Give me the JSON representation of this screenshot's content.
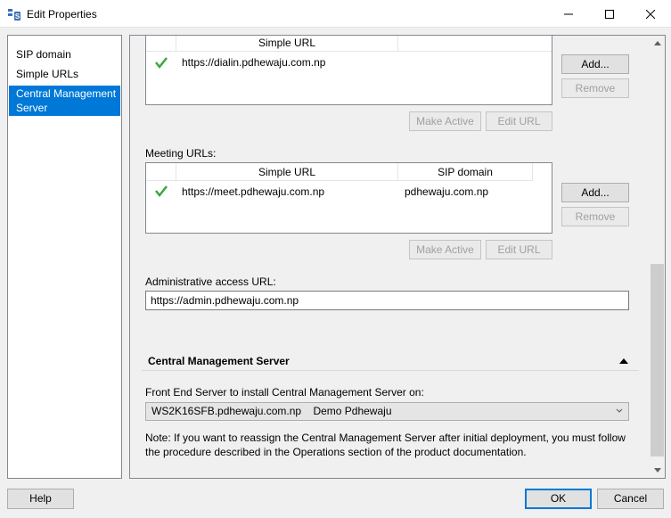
{
  "window": {
    "title": "Edit Properties",
    "icon": "skype-server-icon",
    "controls": {
      "minimize": "minimize-icon",
      "maximize": "maximize-icon",
      "close": "close-icon"
    }
  },
  "nav": {
    "items": [
      {
        "label": "SIP domain",
        "selected": false
      },
      {
        "label": "Simple URLs",
        "selected": false
      },
      {
        "label": "Central Management Server",
        "selected": true
      }
    ]
  },
  "dialin": {
    "column_header": "Simple URL",
    "rows": [
      {
        "url": "https://dialin.pdhewaju.com.np",
        "active": true
      }
    ],
    "add_label": "Add...",
    "remove_label": "Remove",
    "make_active_label": "Make Active",
    "edit_url_label": "Edit URL"
  },
  "meeting": {
    "label": "Meeting URLs:",
    "headers": {
      "simple_url": "Simple URL",
      "sip_domain": "SIP domain"
    },
    "rows": [
      {
        "url": "https://meet.pdhewaju.com.np",
        "sip_domain": "pdhewaju.com.np",
        "active": true
      }
    ],
    "add_label": "Add...",
    "remove_label": "Remove",
    "make_active_label": "Make Active",
    "edit_url_label": "Edit URL"
  },
  "admin": {
    "label": "Administrative access URL:",
    "value": "https://admin.pdhewaju.com.np"
  },
  "cms": {
    "section_title": "Central Management Server",
    "front_end_label": "Front End Server to install Central Management Server on:",
    "selected_server": "WS2K16SFB.pdhewaju.com.np",
    "selected_site": "Demo Pdhewaju",
    "note_line1": "Note: If you want to reassign the Central Management Server after initial deployment, you must follow",
    "note_line2": "the procedure described in the Operations section of the product documentation."
  },
  "footer": {
    "help_label": "Help",
    "ok_label": "OK",
    "cancel_label": "Cancel"
  },
  "colors": {
    "accent": "#0078d7",
    "check": "#3aa83a"
  }
}
